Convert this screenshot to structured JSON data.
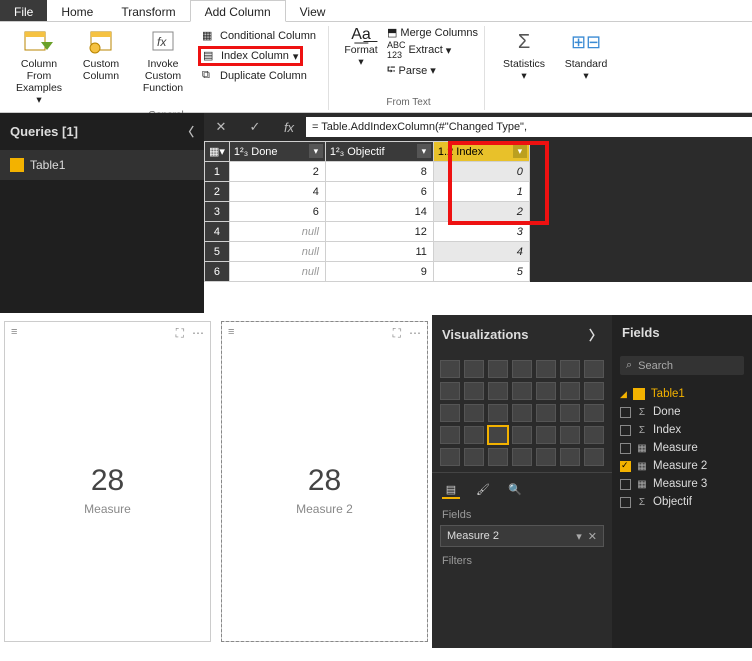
{
  "tabs": {
    "file": "File",
    "home": "Home",
    "transform": "Transform",
    "addcol": "Add Column",
    "view": "View"
  },
  "ribbon": {
    "general_label": "General",
    "from_text_label": "From Text",
    "col_from_examples": "Column From Examples",
    "custom_column": "Custom Column",
    "invoke_custom": "Invoke Custom Function",
    "conditional": "Conditional Column",
    "index": "Index Column",
    "duplicate": "Duplicate Column",
    "format": "Format",
    "merge": "Merge Columns",
    "extract": "Extract",
    "parse": "Parse",
    "statistics": "Statistics",
    "standard": "Standard"
  },
  "queries": {
    "title": "Queries [1]",
    "items": [
      "Table1"
    ]
  },
  "formula": "= Table.AddIndexColumn(#\"Changed Type\",",
  "columns": {
    "done": "Done",
    "objectif": "Objectif",
    "index": "Index",
    "type_prefix": "1²₃",
    "type_prefix_dec": "1.2"
  },
  "rows": [
    {
      "n": 1,
      "done": "2",
      "obj": "8",
      "idx": "0"
    },
    {
      "n": 2,
      "done": "4",
      "obj": "6",
      "idx": "1"
    },
    {
      "n": 3,
      "done": "6",
      "obj": "14",
      "idx": "2"
    },
    {
      "n": 4,
      "done": "null",
      "obj": "12",
      "idx": "3"
    },
    {
      "n": 5,
      "done": "null",
      "obj": "11",
      "idx": "4"
    },
    {
      "n": 6,
      "done": "null",
      "obj": "9",
      "idx": "5"
    }
  ],
  "cards": [
    {
      "value": "28",
      "label": "Measure"
    },
    {
      "value": "28",
      "label": "Measure 2"
    }
  ],
  "viz_pane": {
    "title": "Visualizations",
    "fields_label": "Fields",
    "filters_label": "Filters",
    "well_value": "Measure 2"
  },
  "fields_pane": {
    "title": "Fields",
    "search": "Search",
    "table": "Table1",
    "items": [
      {
        "name": "Done",
        "sigma": true,
        "checked": false
      },
      {
        "name": "Index",
        "sigma": true,
        "checked": false
      },
      {
        "name": "Measure",
        "sigma": false,
        "checked": false,
        "measure": true
      },
      {
        "name": "Measure 2",
        "sigma": false,
        "checked": true,
        "measure": true
      },
      {
        "name": "Measure 3",
        "sigma": false,
        "checked": false,
        "measure": true
      },
      {
        "name": "Objectif",
        "sigma": true,
        "checked": false
      }
    ]
  },
  "chart_data": {
    "type": "table",
    "columns": [
      "Done",
      "Objectif",
      "Index"
    ],
    "data": [
      [
        2,
        8,
        0
      ],
      [
        4,
        6,
        1
      ],
      [
        6,
        14,
        2
      ],
      [
        null,
        12,
        3
      ],
      [
        null,
        11,
        4
      ],
      [
        null,
        9,
        5
      ]
    ]
  }
}
